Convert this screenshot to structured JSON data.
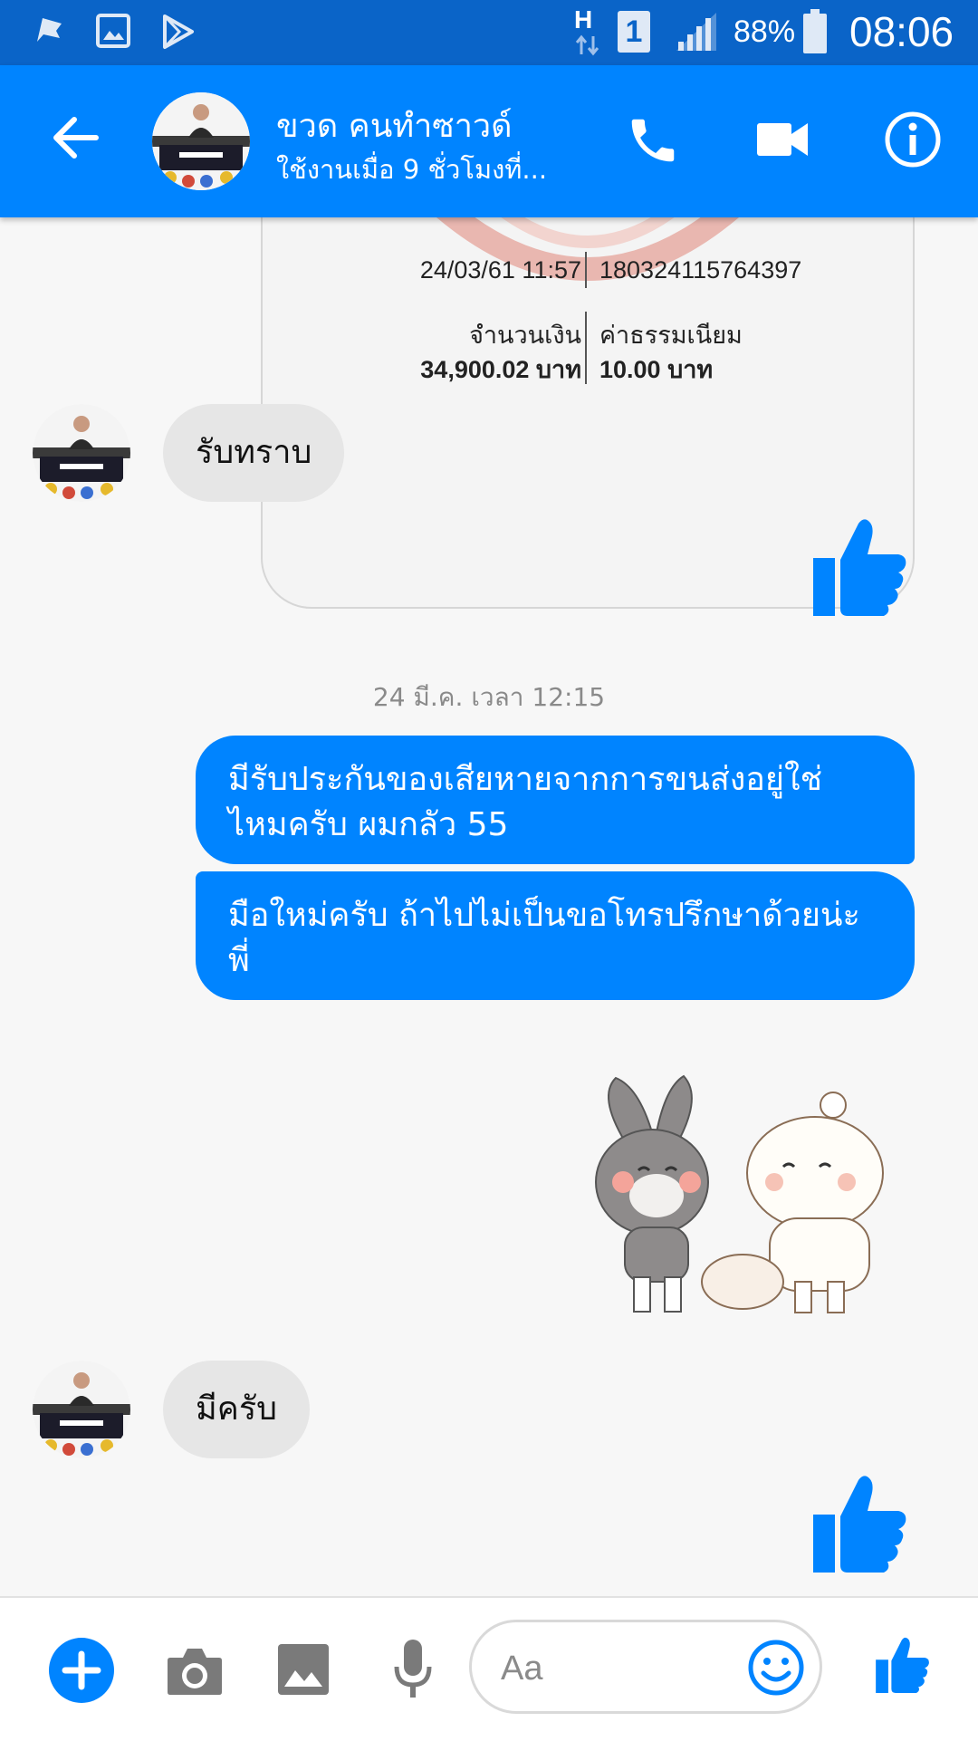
{
  "status_bar": {
    "network_type": "H",
    "sim_slot": "1",
    "battery_percent": "88%",
    "time": "08:06",
    "left_icons": [
      "flag-icon",
      "gallery-icon",
      "play-store-icon"
    ]
  },
  "header": {
    "contact_name": "ขวด คนทำซาวด์",
    "contact_status": "ใช้งานเมื่อ 9 ชั่วโมงที่...",
    "accent_color": "#0084ff"
  },
  "receipt": {
    "datetime": "24/03/61 11:57",
    "reference": "180324115764397",
    "amount_label": "จำนวนเงิน",
    "amount": "34,900.02 บาท",
    "fee_label": "ค่าธรรมเนียม",
    "fee": "10.00 บาท"
  },
  "messages": {
    "in_1": "รับทราบ",
    "timestamp": "24 มี.ค. เวลา 12:15",
    "out_1_line1": "มีรับประกันของเสียหายจากการขนส่งอยู่ใช่",
    "out_1_line2": "ไหมครับ ผมกลัว 55",
    "out_2_line1": "มือใหม่ครับ ถ้าไปไม่เป็นขอโทรปรึกษาด้วยน่ะ",
    "out_2_line2": "พี่",
    "in_2": "มีครับ"
  },
  "composer": {
    "placeholder": "Aa"
  }
}
